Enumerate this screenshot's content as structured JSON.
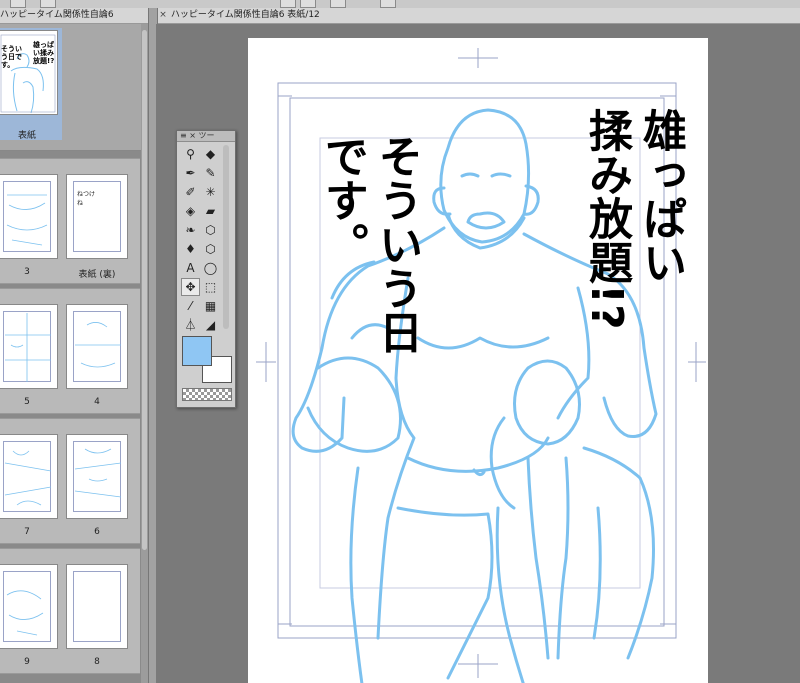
{
  "document_tabs": {
    "left_tab_label": "ハッピータイム関係性自論6",
    "active_tab_label": "ハッピータイム関係性自論6 表紙/12"
  },
  "page_manager": {
    "cover_label": "表紙",
    "pages": [
      {
        "left": "3",
        "right": "表紙 (裏)"
      },
      {
        "left": "5",
        "right": "4"
      },
      {
        "left": "7",
        "right": "6"
      },
      {
        "left": "9",
        "right": "8"
      }
    ]
  },
  "tool_palette": {
    "title": "ツー",
    "close_symbol": "×",
    "menu_symbol": "≡",
    "foreground_color": "#8fc6f3",
    "background_color": "#ffffff",
    "tools": [
      "zoom-icon",
      "eraser-icon",
      "pen-icon",
      "pencil-icon",
      "brush-icon",
      "sparkle-icon",
      "fill-icon",
      "decoration-icon",
      "blend-icon",
      "lasso-icon",
      "drop-icon",
      "shape-icon",
      "text-icon",
      "balloon-icon",
      "move-icon",
      "select-icon",
      "eyedropper-icon",
      "gradient-icon",
      "ruler-icon",
      "frame-icon"
    ]
  },
  "canvas": {
    "title_lines": [
      "雄っぱい",
      "揉み放題!?",
      "そういう日",
      "です。"
    ],
    "sketch_color": "#7cc1ef"
  }
}
